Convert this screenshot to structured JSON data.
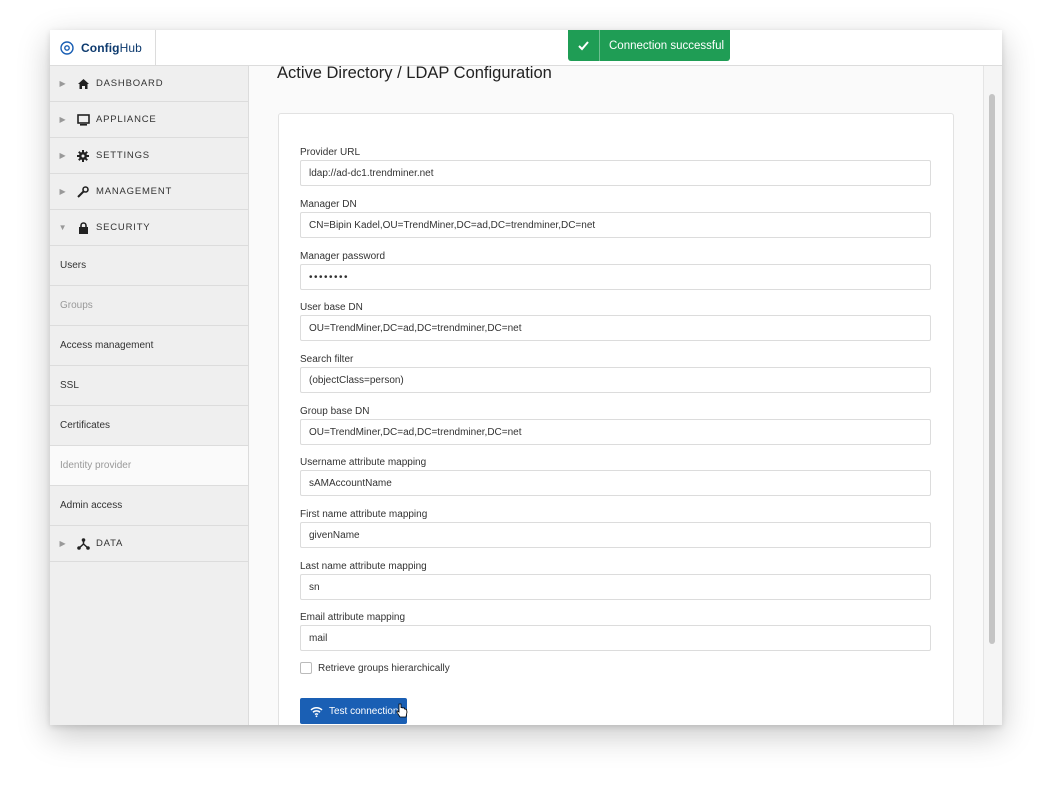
{
  "app": {
    "brand_prefix": "Config",
    "brand_suffix": "Hub",
    "logo_icon": "gear-circle-icon"
  },
  "toast": {
    "message": "Connection successful",
    "icon": "check-icon",
    "color": "#1f9d55"
  },
  "sidebar": {
    "sections": [
      {
        "label": "DASHBOARD",
        "icon": "home-icon",
        "expanded": false
      },
      {
        "label": "APPLIANCE",
        "icon": "monitor-icon",
        "expanded": false
      },
      {
        "label": "SETTINGS",
        "icon": "gear-icon",
        "expanded": false
      },
      {
        "label": "MANAGEMENT",
        "icon": "wrench-icon",
        "expanded": false
      },
      {
        "label": "SECURITY",
        "icon": "lock-icon",
        "expanded": true
      },
      {
        "label": "DATA",
        "icon": "network-icon",
        "expanded": false
      }
    ],
    "security_items": [
      {
        "label": "Users"
      },
      {
        "label": "Groups"
      },
      {
        "label": "Access management"
      },
      {
        "label": "SSL"
      },
      {
        "label": "Certificates"
      },
      {
        "label": "Identity provider"
      },
      {
        "label": "Admin access"
      }
    ]
  },
  "main": {
    "title": "Active Directory / LDAP Configuration",
    "fields": [
      {
        "label": "Provider URL",
        "value": "ldap://ad-dc1.trendminer.net"
      },
      {
        "label": "Manager DN",
        "value": "CN=Bipin Kadel,OU=TrendMiner,DC=ad,DC=trendminer,DC=net"
      },
      {
        "label": "Manager password",
        "value": "••••••••"
      },
      {
        "label": "User base DN",
        "value": "OU=TrendMiner,DC=ad,DC=trendminer,DC=net"
      },
      {
        "label": "Search filter",
        "value": "(objectClass=person)"
      },
      {
        "label": "Group base DN",
        "value": "OU=TrendMiner,DC=ad,DC=trendminer,DC=net"
      },
      {
        "label": "Username attribute mapping",
        "value": "sAMAccountName"
      },
      {
        "label": "First name attribute mapping",
        "value": "givenName"
      },
      {
        "label": "Last name attribute mapping",
        "value": "sn"
      },
      {
        "label": "Email attribute mapping",
        "value": "mail"
      }
    ],
    "checkbox_label": "Retrieve groups hierarchically",
    "test_button_label": "Test connection",
    "test_button_icon": "wifi-icon",
    "accent": "#1a5fb4"
  }
}
